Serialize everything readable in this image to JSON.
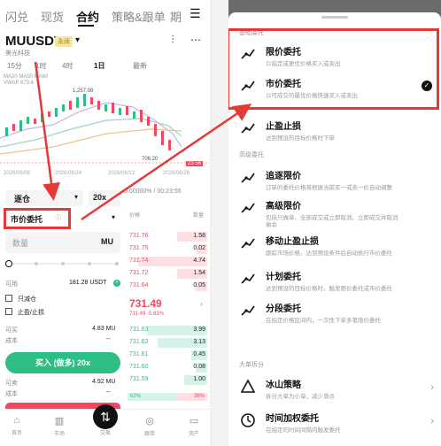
{
  "left": {
    "nav": [
      "闪兑",
      "现货",
      "合约",
      "策略&跟单",
      "期"
    ],
    "symbol": "MUUSDT",
    "tag": "永续",
    "subname": "美光科技",
    "timeframes": [
      "15分",
      "1时",
      "4时",
      "1日",
      "最新"
    ],
    "ma_line1": "MA20  MA50  MA60",
    "ma_line2": "VWAP  673.4",
    "chart_high": "1,257.08",
    "chart_price": "706.20",
    "chart_last": "23.56",
    "dates": [
      "2026/06/08",
      "2026/06/24",
      "2026/06/12",
      "2026/06/26"
    ],
    "pct_label": "0.00000% / 00:23:55",
    "open_label": "逐仓",
    "leverage": "20x",
    "order_type": "市价委托",
    "qty_placeholder": "数量",
    "qty_unit": "MU",
    "avail_label": "可用",
    "avail_value": "181.28 USDT",
    "reduce_only": "只减仓",
    "tpsl": "止盈/止损",
    "buy_max_label": "可买",
    "buy_max_value": "4.83 MU",
    "cost_label": "成本",
    "buy_button": "买入 (做多) 20x",
    "sell_max_label": "可卖",
    "sell_max_value": "4.92 MU",
    "sell_cost_label": "成本",
    "book_header_price": "价格",
    "book_header_qty": "数量",
    "asks": [
      {
        "p": "731.76",
        "q": "1.58"
      },
      {
        "p": "731.75",
        "q": "0.02"
      },
      {
        "p": "731.74",
        "q": "4.74"
      },
      {
        "p": "731.72",
        "q": "1.54"
      },
      {
        "p": "731.64",
        "q": "0.05"
      }
    ],
    "mid_price": "731.49",
    "mid_sub": "731.49  -5.83%",
    "bids": [
      {
        "p": "731.63",
        "q": "3.99"
      },
      {
        "p": "731.62",
        "q": "3.13"
      },
      {
        "p": "731.61",
        "q": "0.45"
      },
      {
        "p": "731.60",
        "q": "0.08"
      },
      {
        "p": "731.59",
        "q": "1.00"
      }
    ],
    "ratio_buy": "62%",
    "ratio_sell": "38%",
    "bottom_nav": [
      "首页",
      "市场",
      "交易",
      "跟单",
      "资产"
    ],
    "colors": {
      "buy": "#2ebd85",
      "sell": "#f6465d"
    }
  },
  "right": {
    "section_basic": "基础委托",
    "section_advanced": "高级委托",
    "section_split": "大单拆分",
    "options": [
      {
        "title": "限价委托",
        "desc": "以指定或更优价格买入或卖出"
      },
      {
        "title": "市价委托",
        "desc": "以可成交的最优价格快速买入或卖出"
      },
      {
        "title": "止盈止损",
        "desc": "达到预设的目标价格时下单"
      },
      {
        "title": "追逐限价",
        "desc": "订单的委托价格将根据当前买一或卖一价自动调整"
      },
      {
        "title": "高级限价",
        "desc": "包括只做单、全部成交或立即取消、立即成交并取消",
        "desc2": "剩余"
      },
      {
        "title": "移动止盈止损",
        "desc": "跟踪市场价格，达到预设条件后自动执行市价委托"
      },
      {
        "title": "计划委托",
        "desc": "达到预设的目标价格时，触发限价委托或市价委托"
      },
      {
        "title": "分段委托",
        "desc": "在指定价格区间内，一次性下单多笔限价委托"
      },
      {
        "title": "冰山策略",
        "desc": "拆分大单为小单，减少滑点"
      },
      {
        "title": "时间加权委托",
        "desc": "在指定的时间间隔内触发委托"
      }
    ]
  }
}
